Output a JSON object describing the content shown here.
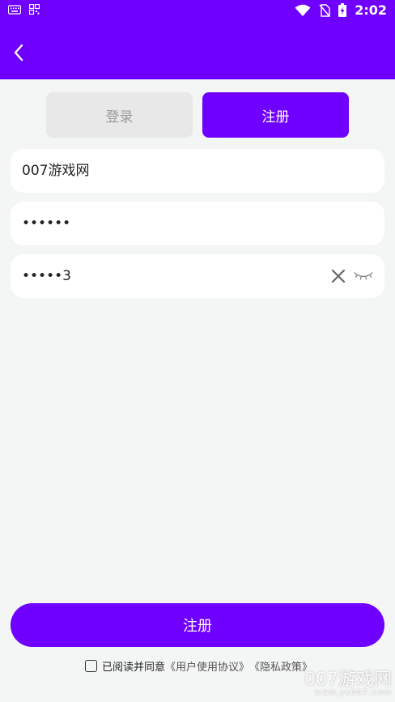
{
  "status_bar": {
    "time": "2:02",
    "left_icons": [
      "keyboard-icon",
      "qr-icon"
    ],
    "right_icons": [
      "wifi-icon",
      "no-sim-icon",
      "battery-charging-icon"
    ]
  },
  "app_bar": {
    "back_icon": "chevron-left-icon",
    "background": "#6f00ff"
  },
  "tabs": [
    {
      "label": "登录",
      "active": false
    },
    {
      "label": "注册",
      "active": true
    }
  ],
  "form": {
    "username": {
      "value": "007游戏网"
    },
    "password": {
      "value": "••••••"
    },
    "confirm_password": {
      "value": "•••••3",
      "icons": [
        "close-icon",
        "eye-closed-icon"
      ]
    }
  },
  "submit": {
    "label": "注册"
  },
  "agreement": {
    "checked": false,
    "text": "已阅读并同意",
    "user_agreement": "《用户使用协议》",
    "privacy_policy": "《隐私政策》"
  },
  "watermark": {
    "brand": "007游戏网",
    "url": "www.yx007.com"
  },
  "colors": {
    "accent": "#6f00ff",
    "background": "#f4f5f5",
    "tab_inactive_bg": "#e8e8e8",
    "tab_inactive_text": "#9a9a9a"
  }
}
